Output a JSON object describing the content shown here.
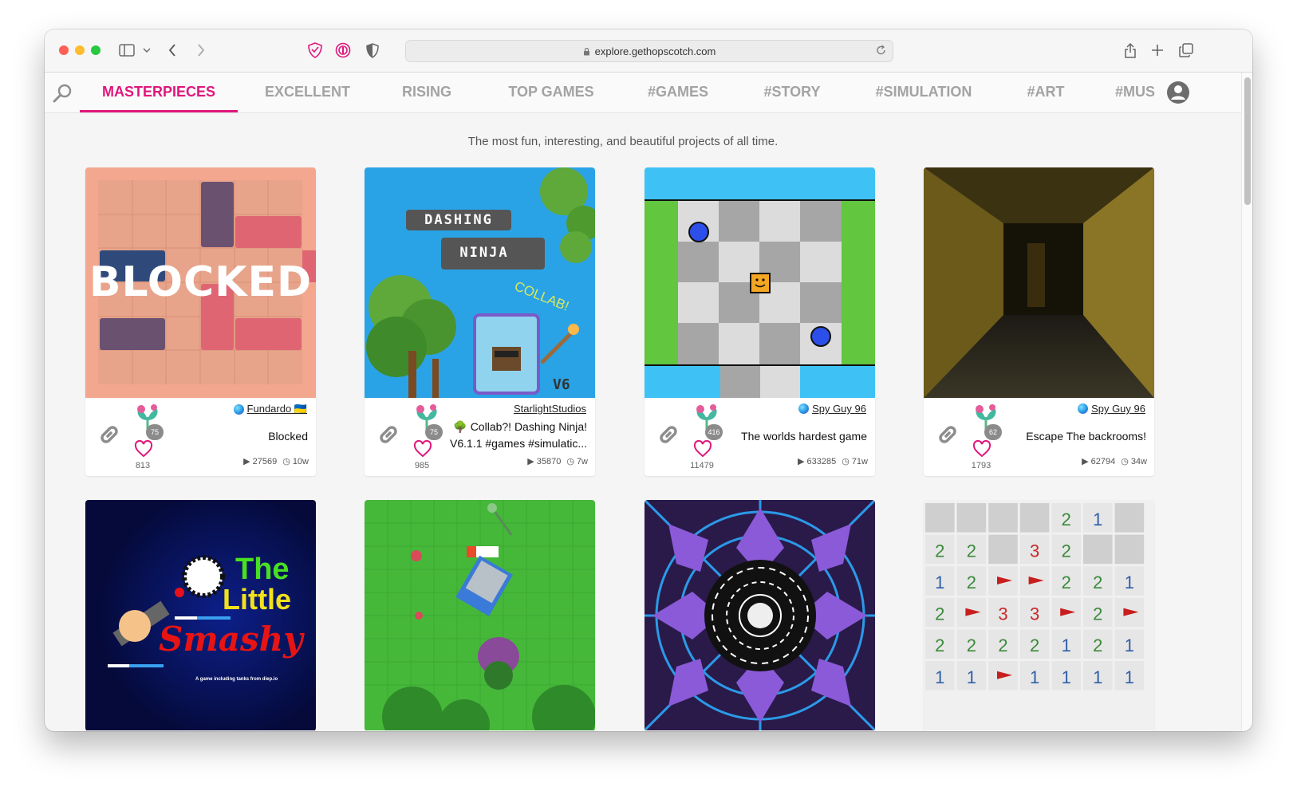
{
  "browser": {
    "url": "explore.gethopscotch.com"
  },
  "nav": {
    "tabs": [
      {
        "label": "MASTERPIECES",
        "active": true
      },
      {
        "label": "EXCELLENT"
      },
      {
        "label": "RISING"
      },
      {
        "label": "TOP GAMES"
      },
      {
        "label": "#GAMES"
      },
      {
        "label": "#STORY"
      },
      {
        "label": "#SIMULATION"
      },
      {
        "label": "#ART"
      },
      {
        "label": "#MUS"
      }
    ]
  },
  "tagline": "The most fun, interesting, and beautiful projects of all time.",
  "colors": {
    "accent": "#e0177c",
    "tab_inactive": "#a3a3a3"
  },
  "projects": [
    {
      "author": "Fundardo 🇺🇦",
      "title": "Blocked",
      "level": "75",
      "likes": "813",
      "plays": "27569",
      "age": "10w"
    },
    {
      "author": "StarlightStudios",
      "title": "🌳 Collab?! Dashing Ninja! V6.1.1 #games #simulatic...",
      "level": "75",
      "likes": "985",
      "plays": "35870",
      "age": "7w"
    },
    {
      "author": "Spy Guy 96",
      "title": "The worlds hardest game",
      "level": "416",
      "likes": "11479",
      "plays": "633285",
      "age": "71w"
    },
    {
      "author": "Spy Guy 96",
      "title": "Escape The backrooms!",
      "level": "62",
      "likes": "1793",
      "plays": "62794",
      "age": "34w"
    }
  ],
  "thumb_text": {
    "blocked": "BLOCKED",
    "dashing": "DASHING",
    "ninja": "NINJA",
    "collab": "COLLAB!",
    "v6": "V6",
    "smashy_1": "The",
    "smashy_2": "Little",
    "smashy_3": "Smashy",
    "smashy_sub": "A game including tanks from diep.io"
  },
  "minesweeper": {
    "rows": [
      [
        "",
        "",
        "",
        "",
        "2",
        "1",
        ""
      ],
      [
        "2",
        "2",
        "",
        "3",
        "2",
        "",
        ""
      ],
      [
        "1",
        "2",
        "F",
        "F",
        "2",
        "2",
        "1"
      ],
      [
        "2",
        "F",
        "3",
        "3",
        "F",
        "2",
        "F"
      ],
      [
        "2",
        "2",
        "2",
        "2",
        "1",
        "2",
        "1"
      ],
      [
        "1",
        "1",
        "F",
        "1",
        "1",
        "1",
        "1"
      ]
    ]
  }
}
